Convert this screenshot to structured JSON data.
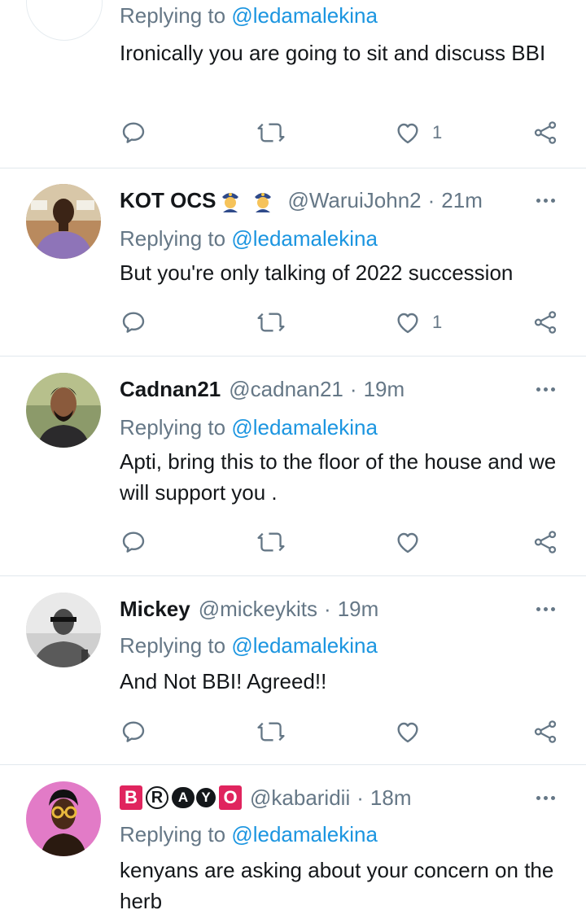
{
  "replying_prefix": "Replying to",
  "tweets": [
    {
      "username": "",
      "handle": "",
      "time": "",
      "reply_to": "@ledamalekina",
      "text": "Ironically you are going to sit and discuss BBI",
      "like_count": "1",
      "retweet_count": "",
      "reply_count": ""
    },
    {
      "username": "KOT OCS",
      "username_emojis": [
        "police-officer-emoji",
        "police-officer-emoji"
      ],
      "handle": "@WaruiJohn2",
      "separator": "·",
      "time": "21m",
      "reply_to": "@ledamalekina",
      "text": "But you're only talking of 2022 succession",
      "like_count": "1"
    },
    {
      "username": "Cadnan21",
      "handle": "@cadnan21",
      "separator": "·",
      "time": "19m",
      "reply_to": "@ledamalekina",
      "text": "Apti, bring this to the floor of the house and we will support you .",
      "like_count": ""
    },
    {
      "username": "Mickey",
      "handle": "@mickeykits",
      "separator": "·",
      "time": "19m",
      "reply_to": "@ledamalekina",
      "text": "And Not BBI! Agreed!!",
      "like_count": ""
    },
    {
      "username_letters": [
        "B",
        "R",
        "A",
        "Y",
        "O"
      ],
      "handle": "@kabaridii",
      "separator": "·",
      "time": "18m",
      "reply_to": "@ledamalekina",
      "text": "kenyans are asking about your concern on the herb"
    }
  ],
  "colors": {
    "mention": "#1b95e0",
    "secondary_text": "#657786",
    "divider": "#e1e8ed",
    "brayo_red": "#e0245e"
  },
  "icons": [
    "reply-icon",
    "retweet-icon",
    "like-icon",
    "share-icon",
    "more-icon"
  ]
}
